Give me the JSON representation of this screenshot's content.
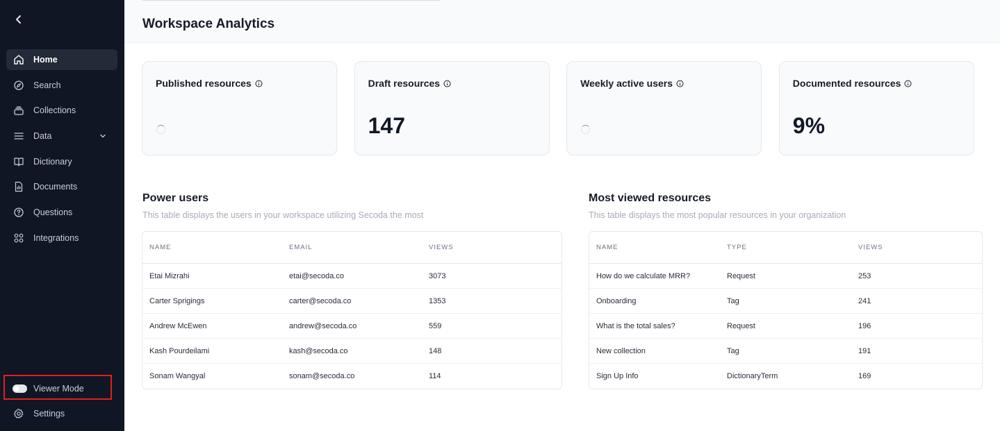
{
  "sidebar": {
    "back_icon": "chevron-left-icon",
    "items": [
      {
        "label": "Home",
        "icon": "home-icon",
        "active": true
      },
      {
        "label": "Search",
        "icon": "compass-icon"
      },
      {
        "label": "Collections",
        "icon": "collections-icon"
      },
      {
        "label": "Data",
        "icon": "list-icon",
        "expandable": true
      },
      {
        "label": "Dictionary",
        "icon": "book-icon"
      },
      {
        "label": "Documents",
        "icon": "document-icon"
      },
      {
        "label": "Questions",
        "icon": "question-icon"
      },
      {
        "label": "Integrations",
        "icon": "grid-icon"
      }
    ],
    "viewer_mode_label": "Viewer Mode",
    "settings_label": "Settings"
  },
  "header": {
    "title": "Workspace Analytics"
  },
  "stats": [
    {
      "title": "Published resources",
      "value": "",
      "loading": true
    },
    {
      "title": "Draft resources",
      "value": "147",
      "loading": false
    },
    {
      "title": "Weekly active users",
      "value": "",
      "loading": true
    },
    {
      "title": "Documented resources",
      "value": "9%",
      "loading": false
    }
  ],
  "power_users": {
    "title": "Power users",
    "subtitle": "This table displays the users in your workspace utilizing Secoda the most",
    "columns": [
      "NAME",
      "EMAIL",
      "VIEWS"
    ],
    "rows": [
      [
        "Etai Mizrahi",
        "etai@secoda.co",
        "3073"
      ],
      [
        "Carter Sprigings",
        "carter@secoda.co",
        "1353"
      ],
      [
        "Andrew McEwen",
        "andrew@secoda.co",
        "559"
      ],
      [
        "Kash Pourdeilami",
        "kash@secoda.co",
        "148"
      ],
      [
        "Sonam Wangyal",
        "sonam@secoda.co",
        "114"
      ]
    ]
  },
  "most_viewed": {
    "title": "Most viewed resources",
    "subtitle": "This table displays the most popular resources in your organization",
    "columns": [
      "NAME",
      "TYPE",
      "VIEWS"
    ],
    "rows": [
      [
        "How do we calculate MRR?",
        "Request",
        "253"
      ],
      [
        "Onboarding",
        "Tag",
        "241"
      ],
      [
        "What is the total sales?",
        "Request",
        "196"
      ],
      [
        "New collection",
        "Tag",
        "191"
      ],
      [
        "Sign Up Info",
        "DictionaryTerm",
        "169"
      ]
    ]
  },
  "colors": {
    "sidebar_bg": "#101624",
    "active_item_bg": "#232a38",
    "annotation_red": "#e02020"
  }
}
